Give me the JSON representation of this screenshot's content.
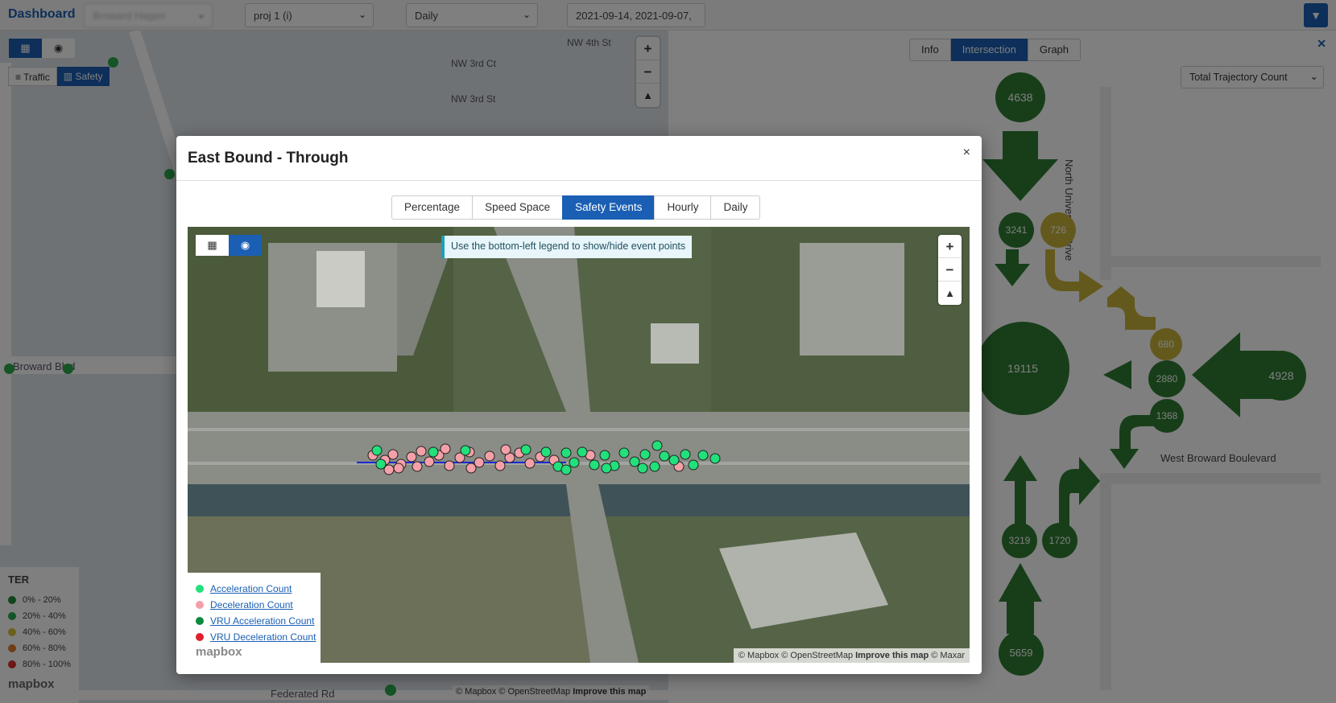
{
  "topbar": {
    "brand": "Dashboard",
    "selects": [
      {
        "value": "Broward Hagen"
      },
      {
        "value": "proj 1 (i)"
      },
      {
        "value": "Daily"
      },
      {
        "value": "2021-09-14, 2021-09-07,"
      }
    ]
  },
  "left_map": {
    "mode_buttons": [
      "Traffic",
      "Safety"
    ],
    "labels": [
      "NW 3rd Ct",
      "NW 4th St",
      "NW 3rd St",
      "Broward Blvd",
      "Federated Rd"
    ],
    "legend": {
      "title": "TER",
      "items": [
        {
          "label": "0% - 20%",
          "color": "#1e8c3a"
        },
        {
          "label": "20% - 40%",
          "color": "#2aa84a"
        },
        {
          "label": "40% - 60%",
          "color": "#d6c23a"
        },
        {
          "label": "60% - 80%",
          "color": "#e07b2a"
        },
        {
          "label": "80% - 100%",
          "color": "#d93030"
        }
      ]
    },
    "attribution": "© Mapbox © OpenStreetMap",
    "improve": "Improve this map",
    "logo": "mapbox"
  },
  "right_panel": {
    "tabs": [
      "Info",
      "Intersection",
      "Graph"
    ],
    "active_tab": "Intersection",
    "metric_select": "Total Trajectory Count",
    "street_ns": "North University Drive",
    "street_ew": "West Broward Boulevard",
    "counts": {
      "n_in": "4638",
      "n_left": "3241",
      "n_right": "726",
      "e_left": "680",
      "e_through": "2880",
      "e_right": "1368",
      "e_in": "4928",
      "w_in": "19115",
      "s_through": "3219",
      "s_right": "1720",
      "s_in": "5659"
    }
  },
  "modal": {
    "title": "East Bound - Through",
    "close": "×",
    "tabs": [
      "Percentage",
      "Speed Space",
      "Safety Events",
      "Hourly",
      "Daily"
    ],
    "active_tab": "Safety Events",
    "tip": "Use the bottom-left legend to show/hide event points",
    "legend": [
      {
        "label": "Acceleration Count",
        "color": "#22e07a"
      },
      {
        "label": "Deceleration Count",
        "color": "#f4a0a8"
      },
      {
        "label": "VRU Acceleration Count",
        "color": "#0c8a3e"
      },
      {
        "label": "VRU Deceleration Count",
        "color": "#e01f2f"
      }
    ],
    "logo": "mapbox",
    "attribution": "© Mapbox © OpenStreetMap",
    "improve": "Improve this map",
    "attribution_tail": "© Maxar"
  }
}
